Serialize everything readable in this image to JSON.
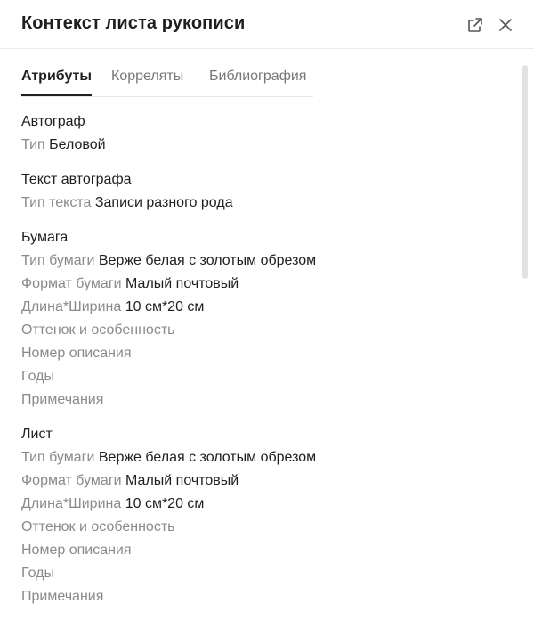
{
  "header": {
    "title": "Контекст листа рукописи"
  },
  "tabs": [
    {
      "label": "Атрибуты"
    },
    {
      "label": "Корреляты"
    },
    {
      "label": "Библиография"
    }
  ],
  "sections": [
    {
      "title": "Автограф",
      "rows": [
        {
          "label": "Тип",
          "value": "Беловой"
        }
      ]
    },
    {
      "title": "Текст автографа",
      "rows": [
        {
          "label": "Тип текста",
          "value": "Записи разного рода"
        }
      ]
    },
    {
      "title": "Бумага",
      "rows": [
        {
          "label": "Тип бумаги",
          "value": "Верже белая с золотым обрезом"
        },
        {
          "label": "Формат бумаги",
          "value": "Малый почтовый"
        },
        {
          "label": "Длина*Ширина",
          "value": "10 см*20 см"
        },
        {
          "label": "Оттенок и особенность",
          "value": ""
        },
        {
          "label": "Номер описания",
          "value": ""
        },
        {
          "label": "Годы",
          "value": ""
        },
        {
          "label": "Примечания",
          "value": ""
        }
      ]
    },
    {
      "title": "Лист",
      "rows": [
        {
          "label": "Тип бумаги",
          "value": "Верже белая с золотым обрезом"
        },
        {
          "label": "Формат бумаги",
          "value": "Малый почтовый"
        },
        {
          "label": "Длина*Ширина",
          "value": "10 см*20 см"
        },
        {
          "label": "Оттенок и особенность",
          "value": ""
        },
        {
          "label": "Номер описания",
          "value": ""
        },
        {
          "label": "Годы",
          "value": ""
        },
        {
          "label": "Примечания",
          "value": ""
        }
      ]
    }
  ]
}
